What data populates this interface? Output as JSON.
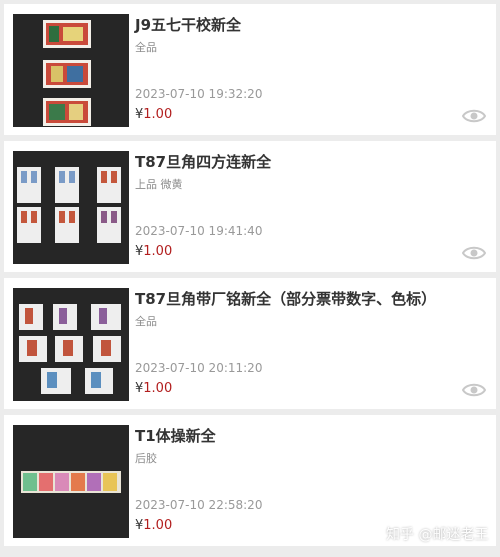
{
  "listings": [
    {
      "title": "J9五七干校新全",
      "grade": "全品",
      "time": "2023-07-10 19:32:20",
      "currency": "¥",
      "price": "1.00"
    },
    {
      "title": "T87旦角四方连新全",
      "grade": "上品 微黄",
      "time": "2023-07-10 19:41:40",
      "currency": "¥",
      "price": "1.00"
    },
    {
      "title": "T87旦角带厂铭新全（部分票带数字、色标）",
      "grade": "全品",
      "time": "2023-07-10 20:11:20",
      "currency": "¥",
      "price": "1.00"
    },
    {
      "title": "T1体操新全",
      "grade": "后胶",
      "time": "2023-07-10 22:58:20",
      "currency": "¥",
      "price": "1.00"
    }
  ],
  "icons": {
    "view": "eye-icon"
  },
  "watermark": "知乎 @邮迷老王",
  "colors": {
    "price": "#b21e1e",
    "background": "#ececec",
    "thumb_bg": "#262626"
  }
}
